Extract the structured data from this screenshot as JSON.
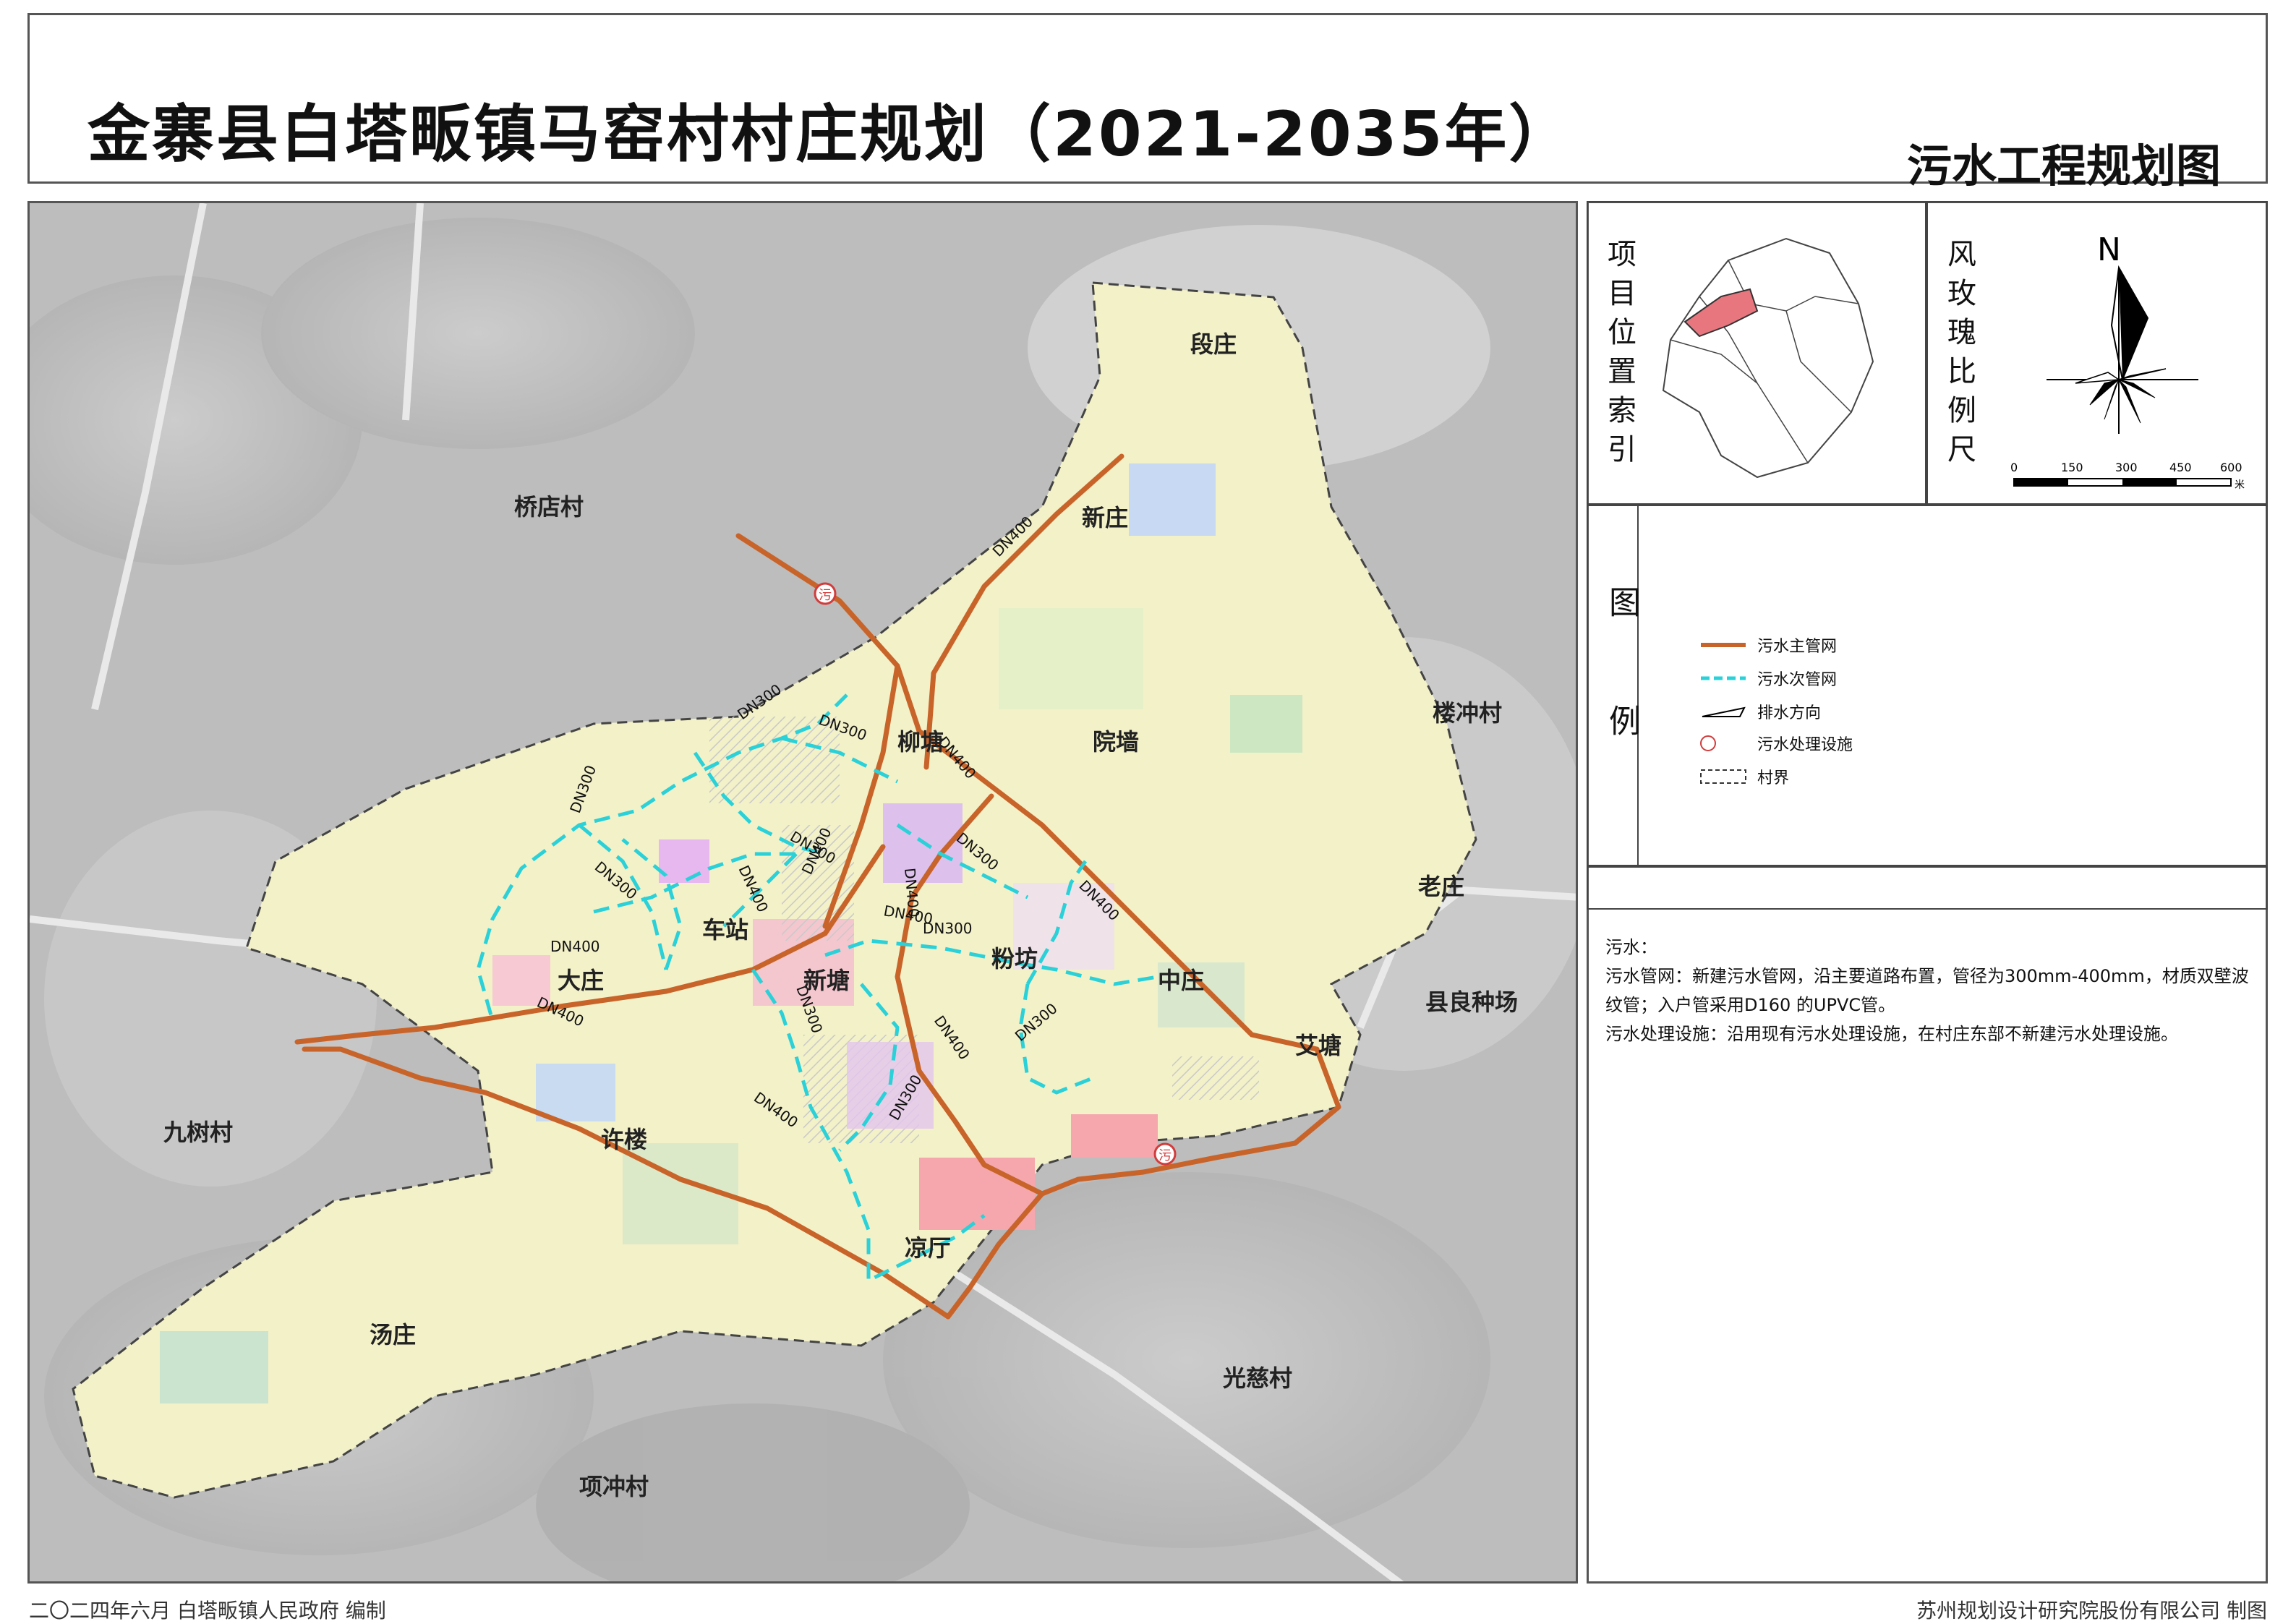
{
  "title": {
    "main": "金寨县白塔畈镇马窑村村庄规划（2021-2035年）",
    "sheet": "污水工程规划图"
  },
  "side_panel": {
    "location_label": "项目位置索引",
    "compass_label": "风玫瑰比例尺",
    "north": "N",
    "scale_ticks": [
      "0",
      "150",
      "300",
      "450",
      "600"
    ],
    "scale_unit": "米",
    "legend_label": "图例"
  },
  "legend": [
    {
      "label": "污水主管网",
      "color": "#c8642a",
      "icon": "main-pipe-line"
    },
    {
      "label": "污水次管网",
      "color": "#2ad1d8",
      "icon": "secondary-pipe-dashed-line"
    },
    {
      "label": "排水方向",
      "color": "#000000",
      "icon": "flow-direction-arrow"
    },
    {
      "label": "污水处理设施",
      "color": "#d23c3c",
      "icon": "treatment-facility-circle"
    },
    {
      "label": "村界",
      "color": "#333333",
      "icon": "village-boundary-dashed-box"
    }
  ],
  "notes": {
    "heading": "污水：",
    "network": "污水管网：新建污水管网，沿主要道路布置，管径为300mm-400mm，材质双壁波纹管；入户管采用D160 的UPVC管。",
    "facility": "污水处理设施：沿用现有污水处理设施，在村庄东部不新建污水处理设施。"
  },
  "map": {
    "places_outside": [
      "桥店村",
      "楼冲村",
      "老庄",
      "县良种场",
      "九树村",
      "光慈村",
      "项冲村"
    ],
    "places_inside": [
      "段庄",
      "新庄",
      "院墙",
      "柳塘",
      "车站",
      "新塘",
      "粉坊",
      "中庄",
      "艾塘",
      "大庄",
      "许楼",
      "凉厅",
      "汤庄"
    ],
    "pipe_labels": [
      "DN400",
      "DN300",
      "DN300",
      "DN400",
      "DN300",
      "DN300",
      "DN300",
      "DN400",
      "DN400",
      "DN300",
      "DN400",
      "DN400",
      "DN300",
      "DN400",
      "DN300",
      "DN400",
      "DN300",
      "DN400",
      "DN400",
      "DN300",
      "DN400"
    ],
    "facility_glyph": "污"
  },
  "footer": {
    "left": "二〇二四年六月  白塔畈镇人民政府  编制",
    "right": "苏州规划设计研究院股份有限公司  制图"
  }
}
